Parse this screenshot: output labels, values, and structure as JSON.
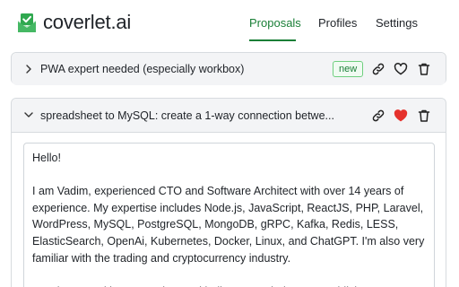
{
  "brand": {
    "name": "coverlet",
    "tld": ".ai",
    "icon": "envelope-check-icon",
    "color": "#2fa84f"
  },
  "nav": {
    "tabs": [
      {
        "label": "Proposals",
        "active": true
      },
      {
        "label": "Profiles",
        "active": false
      },
      {
        "label": "Settings",
        "active": false
      }
    ],
    "active_color": "#1a7f37"
  },
  "proposals": [
    {
      "title": "PWA expert needed (especially workbox)",
      "badge": "new",
      "expanded": false,
      "liked": false,
      "actions": [
        "link-icon",
        "heart-icon",
        "trash-icon"
      ]
    },
    {
      "title": "spreadsheet to MySQL: create a 1-way connection betwe...",
      "expanded": true,
      "liked": true,
      "like_color": "#e5322d",
      "actions": [
        "link-icon",
        "heart-filled-icon",
        "trash-icon"
      ],
      "letter": "Hello!\n\nI am Vadim, experienced CTO and Software Architect with over 14 years of experience. My expertise includes Node.js, JavaScript, ReactJS, PHP, Laravel, WordPress, MySQL, PostgreSQL, MongoDB, gRPC, Kafka, Redis, LESS, ElasticSearch, OpenAi, Kubernetes, Docker, Linux, and ChatGPT. I'm also very familiar with the trading and cryptocurrency industry.\n\nI am interested in your project and believe I can help you establish a one-way"
    }
  ]
}
